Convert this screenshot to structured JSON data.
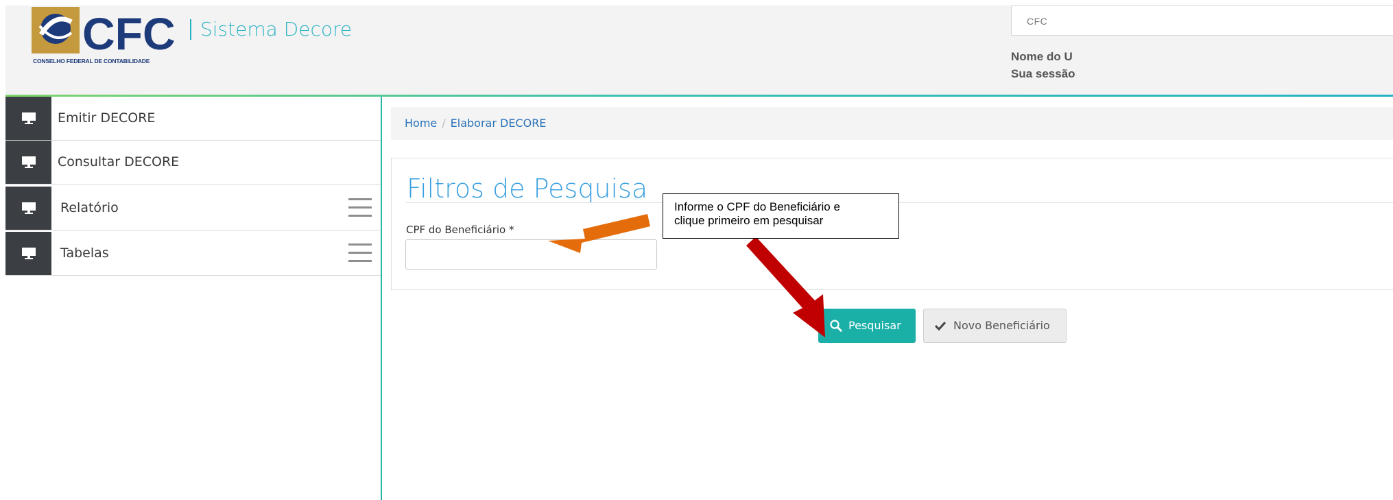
{
  "header": {
    "logo_text": "CFC",
    "logo_subtitle": "CONSELHO FEDERAL DE CONTABILIDADE",
    "app_title": "Sistema Decore",
    "org_field_value": "CFC",
    "user_name_text": "Nome do U",
    "session_text": "Sua sessão"
  },
  "sidebar": {
    "items": [
      {
        "label": "Emitir DECORE",
        "icon": "monitor-icon",
        "has_menu": false
      },
      {
        "label": "Consultar DECORE",
        "icon": "monitor-icon",
        "has_menu": false
      },
      {
        "label": "Relatório",
        "icon": "monitor-icon",
        "has_menu": true
      },
      {
        "label": "Tabelas",
        "icon": "monitor-icon",
        "has_menu": true
      }
    ]
  },
  "breadcrumb": {
    "home": "Home",
    "separator": "/",
    "current": "Elaborar DECORE"
  },
  "filters": {
    "title": "Filtros de Pesquisa",
    "cpf_label": "CPF do Beneficiário *",
    "cpf_value": ""
  },
  "buttons": {
    "search_label": "Pesquisar",
    "new_label": "Novo Beneficiário"
  },
  "annotation": {
    "line1": "Informe o CPF do Beneficiário e",
    "line2": "clique primeiro em pesquisar"
  },
  "colors": {
    "accent": "#1ab0a8",
    "brand_gold": "#c59a3e",
    "brand_navy": "#1d3a7a",
    "sidebar_icon_bg": "#3b3f44",
    "arrow_orange": "#e46c0a",
    "arrow_red": "#c00000"
  }
}
